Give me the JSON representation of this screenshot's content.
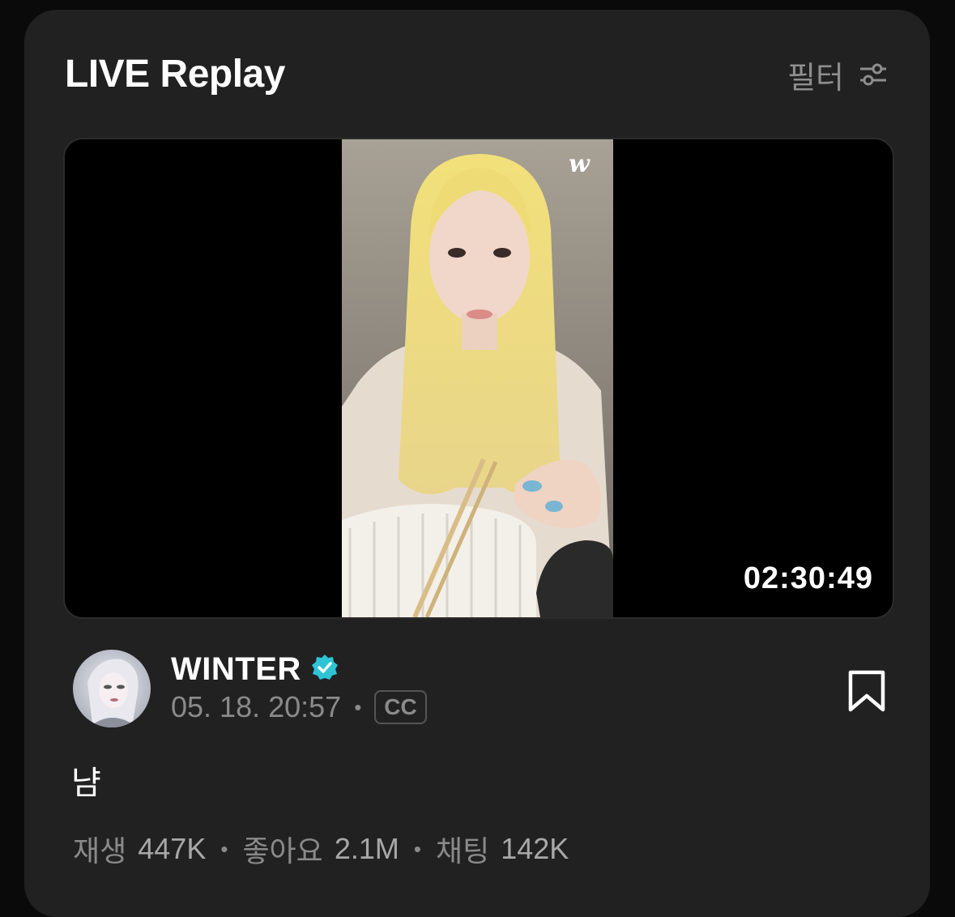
{
  "section": {
    "title": "LIVE Replay",
    "filter_label": "필터"
  },
  "video": {
    "duration": "02:30:49",
    "watermark_icon": "weverse-logo-icon"
  },
  "post": {
    "author": "WINTER",
    "verified_icon": "verified-badge-icon",
    "datetime": "05. 18. 20:57",
    "cc_label": "CC",
    "text": "냠",
    "bookmark_icon": "bookmark-icon"
  },
  "stats": [
    {
      "label": "재생",
      "value": "447K"
    },
    {
      "label": "좋아요",
      "value": "2.1M"
    },
    {
      "label": "채팅",
      "value": "142K"
    }
  ],
  "colors": {
    "card_bg": "#212121",
    "verified": "#2ec4d6",
    "muted_text": "#8a8a8a"
  }
}
